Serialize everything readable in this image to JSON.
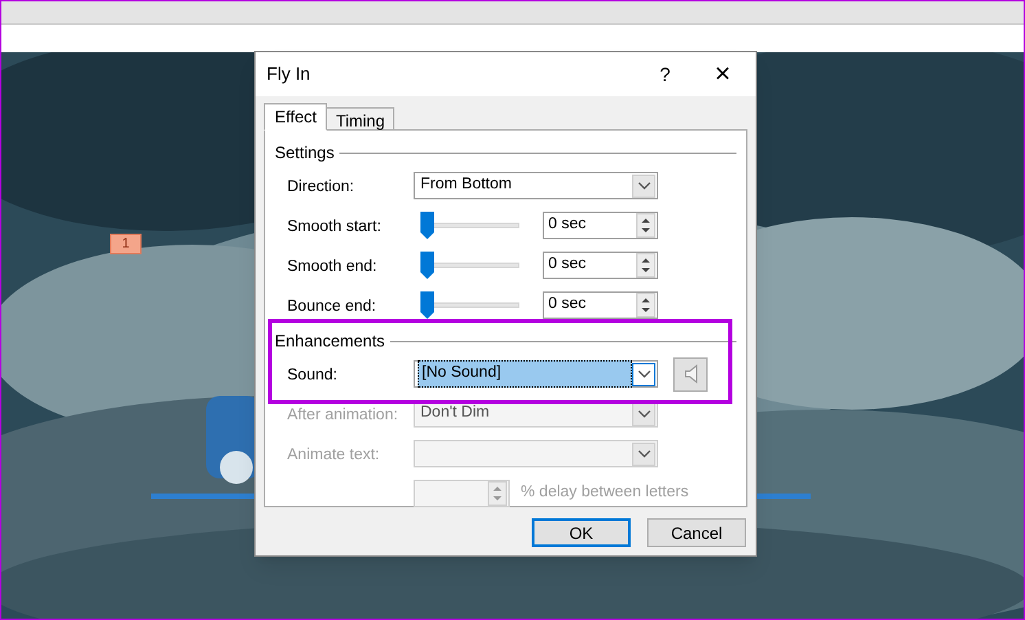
{
  "slide_badge": "1",
  "dialog": {
    "title": "Fly In",
    "help": "?",
    "close": "×",
    "tabs": [
      {
        "label": "Effect",
        "selected": true
      },
      {
        "label": "Timing",
        "selected": false
      }
    ],
    "sections": [
      {
        "title": "Settings",
        "rows": [
          {
            "kind": "dropdown",
            "label": "Direction:",
            "value": "From Bottom",
            "disabled": false,
            "focused": false
          },
          {
            "kind": "slider",
            "label": "Smooth start:",
            "level": 0,
            "value": "0 sec",
            "disabled": false
          },
          {
            "kind": "slider",
            "label": "Smooth end:",
            "level": 0,
            "value": "0 sec",
            "disabled": false
          },
          {
            "kind": "slider",
            "label": "Bounce end:",
            "level": 0,
            "value": "0 sec",
            "disabled": false
          }
        ]
      },
      {
        "title": "Enhancements",
        "rows": [
          {
            "kind": "dropdown",
            "label": "Sound:",
            "value": "[No Sound]",
            "disabled": false,
            "focused": true,
            "speaker": true
          },
          {
            "kind": "dropdown",
            "label": "After animation:",
            "value": "Don't Dim",
            "disabled": true,
            "focused": false
          },
          {
            "kind": "dropdown",
            "label": "Animate text:",
            "disabled": true,
            "focused": false
          },
          {
            "kind": "spin",
            "suffix": "% delay between letters",
            "disabled": true
          }
        ]
      }
    ],
    "buttons": [
      {
        "label": "OK",
        "default": true
      },
      {
        "label": "Cancel",
        "default": false
      }
    ]
  }
}
